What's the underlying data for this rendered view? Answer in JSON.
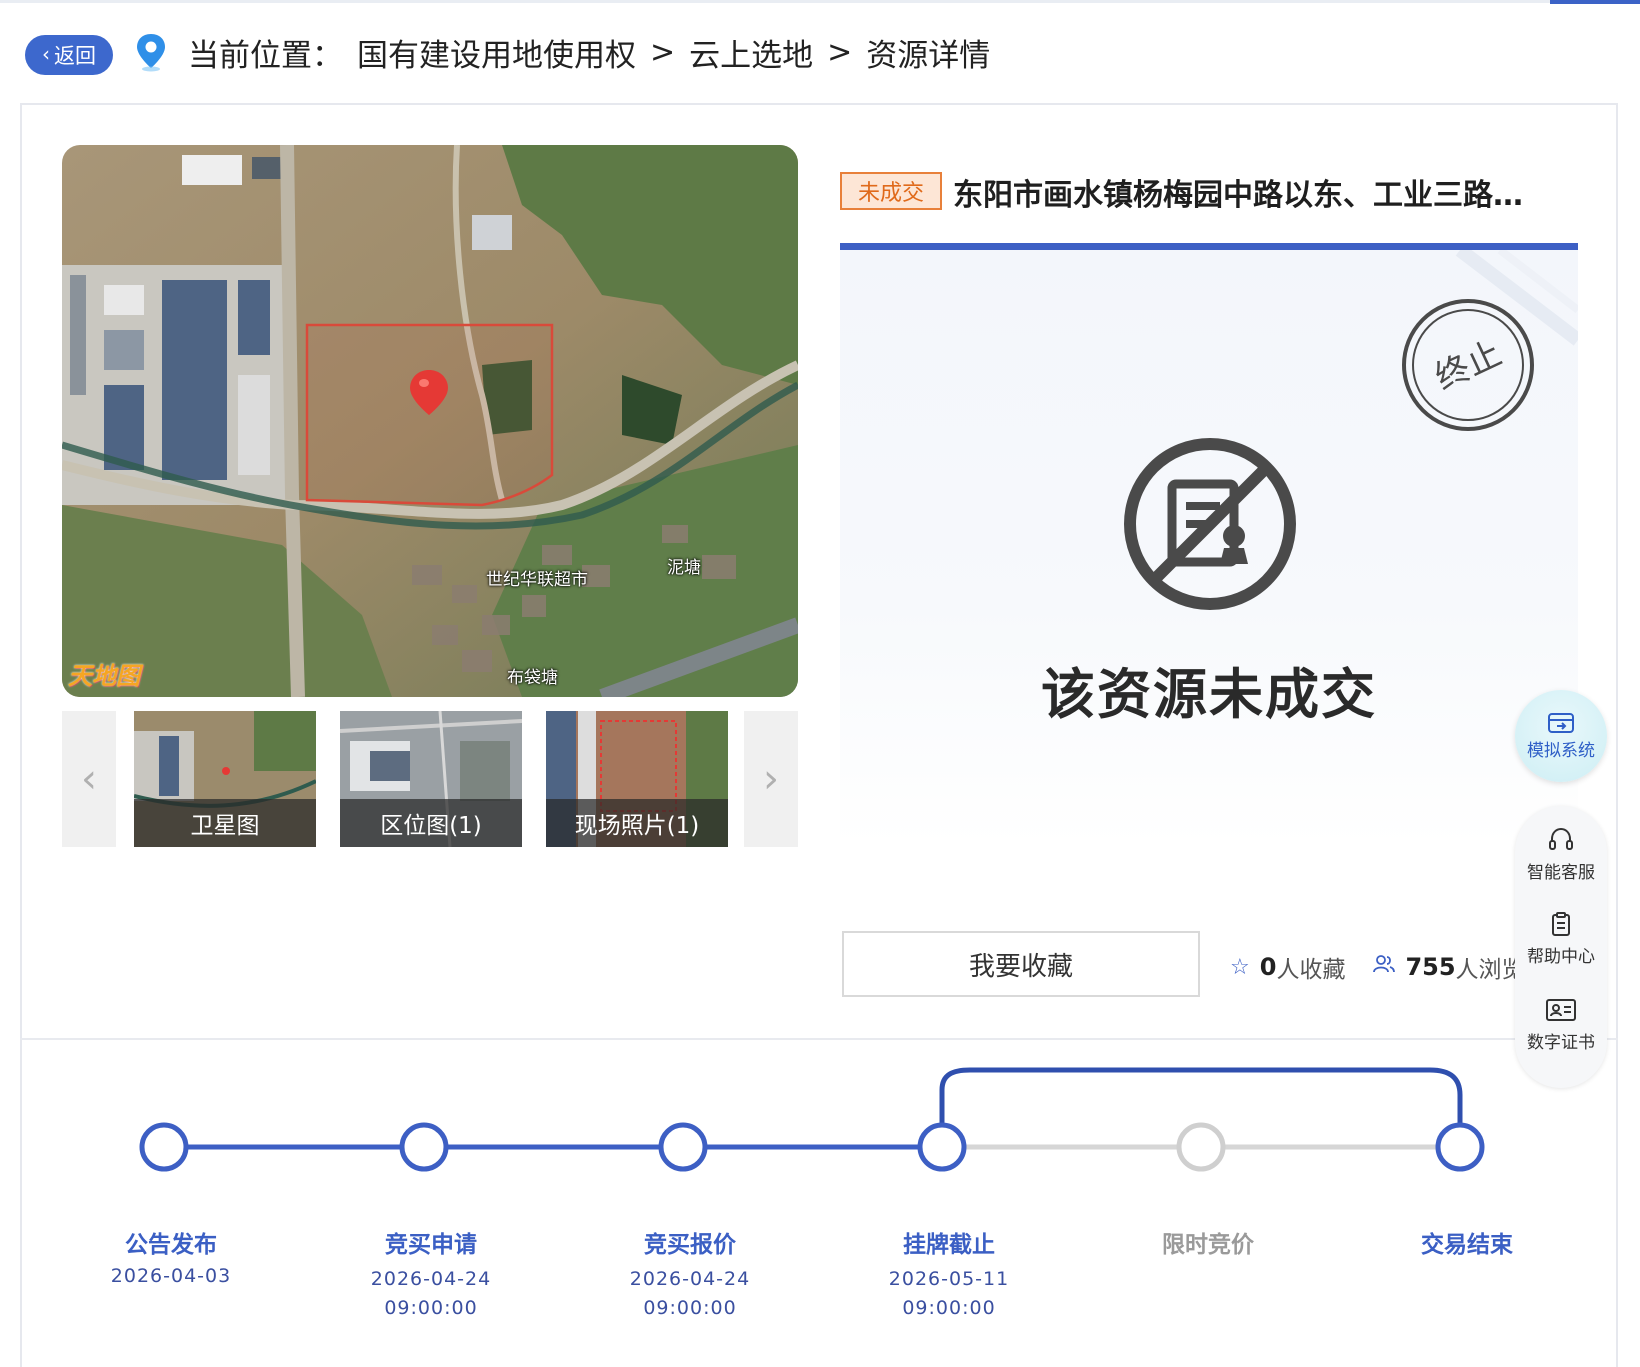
{
  "breadcrumb": {
    "back_label": "返回",
    "prefix": "当前位置：",
    "items": [
      "国有建设用地使用权",
      "云上选地",
      "资源详情"
    ],
    "separator": ">"
  },
  "map": {
    "logo_text": "天地图",
    "labels": [
      "世纪华联超市",
      "泥塘",
      "布袋塘"
    ]
  },
  "thumbnails": [
    {
      "label": "卫星图"
    },
    {
      "label": "区位图(1)"
    },
    {
      "label": "现场照片(1)"
    }
  ],
  "resource": {
    "status_tag": "未成交",
    "title": "东阳市画水镇杨梅园中路以东、工业三路…",
    "stamp_text": "终止",
    "panel_message": "该资源未成交",
    "favorite_button": "我要收藏",
    "favorite_count": "0",
    "favorite_suffix": "人收藏",
    "view_count": "755",
    "view_suffix": "人浏览"
  },
  "tools": {
    "simulate": "模拟系统",
    "service": "智能客服",
    "help": "帮助中心",
    "certificate": "数字证书"
  },
  "timeline": {
    "steps": [
      {
        "label": "公告发布",
        "date": "2026-04-03",
        "time": "",
        "state": "done"
      },
      {
        "label": "竞买申请",
        "date": "2026-04-24",
        "time": "09:00:00",
        "state": "done"
      },
      {
        "label": "竞买报价",
        "date": "2026-04-24",
        "time": "09:00:00",
        "state": "done"
      },
      {
        "label": "挂牌截止",
        "date": "2026-05-11",
        "time": "09:00:00",
        "state": "done"
      },
      {
        "label": "限时竞价",
        "date": "",
        "time": "",
        "state": "skipped"
      },
      {
        "label": "交易结束",
        "date": "",
        "time": "",
        "state": "done"
      }
    ]
  },
  "colors": {
    "accent": "#3d5fc4",
    "tag_orange": "#e06a1b",
    "inactive": "#cfcfcf"
  }
}
